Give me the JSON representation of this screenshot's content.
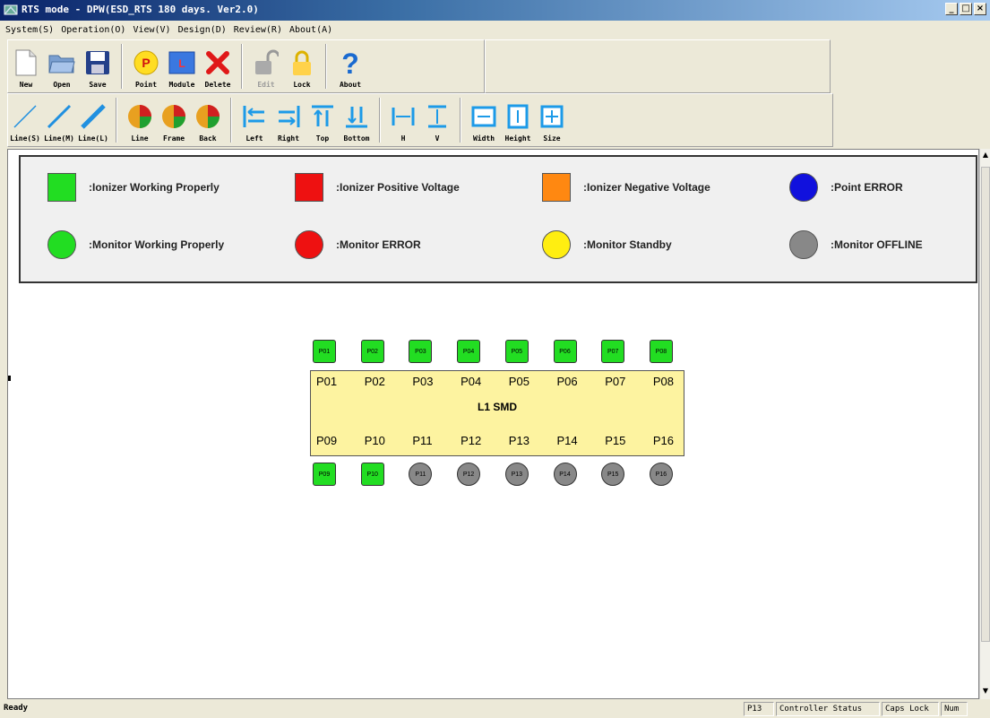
{
  "window": {
    "title": "RTS mode - DPW(ESD_RTS 180 days. Ver2.0)",
    "buttons": [
      "_",
      "□",
      "×"
    ]
  },
  "menu": [
    "System(S)",
    "Operation(O)",
    "View(V)",
    "Design(D)",
    "Review(R)",
    "About(A)"
  ],
  "toolbar1": [
    {
      "label": "New",
      "icon": "new-doc-icon"
    },
    {
      "label": "Open",
      "icon": "open-folder-icon"
    },
    {
      "label": "Save",
      "icon": "save-disk-icon"
    },
    {
      "label": "Point",
      "icon": "point-icon"
    },
    {
      "label": "Module",
      "icon": "module-icon"
    },
    {
      "label": "Delete",
      "icon": "delete-x-icon"
    },
    {
      "label": "Edit",
      "icon": "unlock-icon",
      "disabled": true
    },
    {
      "label": "Lock",
      "icon": "lock-icon"
    },
    {
      "label": "About",
      "icon": "help-icon"
    }
  ],
  "toolbar2": [
    {
      "label": "Line(S)",
      "icon": "line-thin-icon"
    },
    {
      "label": "Line(M)",
      "icon": "line-medium-icon"
    },
    {
      "label": "Line(L)",
      "icon": "line-thick-icon"
    },
    {
      "label": "Line",
      "icon": "line-color-icon"
    },
    {
      "label": "Frame",
      "icon": "frame-color-icon"
    },
    {
      "label": "Back",
      "icon": "back-color-icon"
    },
    {
      "label": "Left",
      "icon": "align-left-icon"
    },
    {
      "label": "Right",
      "icon": "align-right-icon"
    },
    {
      "label": "Top",
      "icon": "align-top-icon"
    },
    {
      "label": "Bottom",
      "icon": "align-bottom-icon"
    },
    {
      "label": "H",
      "icon": "space-h-icon"
    },
    {
      "label": "V",
      "icon": "space-v-icon"
    },
    {
      "label": "Width",
      "icon": "same-width-icon"
    },
    {
      "label": "Height",
      "icon": "same-height-icon"
    },
    {
      "label": "Size",
      "icon": "same-size-icon"
    }
  ],
  "legend": [
    {
      "text": ":Ionizer Working Properly",
      "color": "#22dd22",
      "shape": "square"
    },
    {
      "text": ":Ionizer Positive Voltage",
      "color": "#ee1111",
      "shape": "square"
    },
    {
      "text": ":Ionizer Negative Voltage",
      "color": "#ff8811",
      "shape": "square"
    },
    {
      "text": ":Point ERROR",
      "color": "#1111dd",
      "shape": "circle"
    },
    {
      "text": ":Monitor Working Properly",
      "color": "#22dd22",
      "shape": "circle"
    },
    {
      "text": ":Monitor ERROR",
      "color": "#ee1111",
      "shape": "circle"
    },
    {
      "text": ":Monitor Standby",
      "color": "#ffee11",
      "shape": "circle"
    },
    {
      "text": ":Monitor OFFLINE",
      "color": "#888888",
      "shape": "circle"
    }
  ],
  "module": {
    "title": "L1 SMD",
    "top_labels": [
      "P01",
      "P02",
      "P03",
      "P04",
      "P05",
      "P06",
      "P07",
      "P08"
    ],
    "bottom_labels": [
      "P09",
      "P10",
      "P11",
      "P12",
      "P13",
      "P14",
      "P15",
      "P16"
    ],
    "top_points": [
      {
        "label": "P01",
        "status": "ionizer-ok"
      },
      {
        "label": "P02",
        "status": "ionizer-ok"
      },
      {
        "label": "P03",
        "status": "ionizer-ok"
      },
      {
        "label": "P04",
        "status": "ionizer-ok"
      },
      {
        "label": "P05",
        "status": "ionizer-ok"
      },
      {
        "label": "P06",
        "status": "ionizer-ok"
      },
      {
        "label": "P07",
        "status": "ionizer-ok"
      },
      {
        "label": "P08",
        "status": "ionizer-ok"
      }
    ],
    "bottom_points": [
      {
        "label": "P09",
        "status": "ionizer-ok"
      },
      {
        "label": "P10",
        "status": "ionizer-ok"
      },
      {
        "label": "P11",
        "status": "monitor-offline"
      },
      {
        "label": "P12",
        "status": "monitor-offline"
      },
      {
        "label": "P13",
        "status": "monitor-offline"
      },
      {
        "label": "P14",
        "status": "monitor-offline"
      },
      {
        "label": "P15",
        "status": "monitor-offline"
      },
      {
        "label": "P16",
        "status": "monitor-offline"
      }
    ]
  },
  "colors": {
    "ionizer-ok": "#22dd22",
    "monitor-offline": "#888888",
    "module_fill": "#fdf3a0"
  },
  "statusbar": {
    "ready": "Ready",
    "panes": [
      "P13",
      "Controller Status",
      "Caps Lock",
      "Num"
    ]
  }
}
